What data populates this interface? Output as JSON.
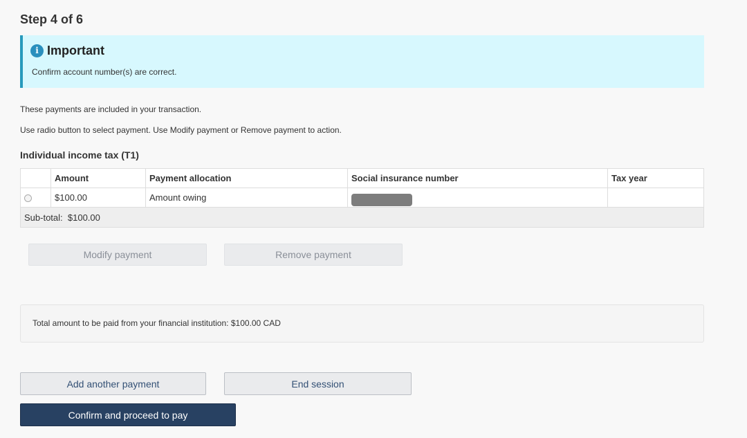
{
  "step": "Step 4 of 6",
  "alert": {
    "icon": "info-icon",
    "icon_glyph": "i",
    "title": "Important",
    "body": "Confirm account number(s) are correct.",
    "accent_color": "#269abc",
    "background_color": "#d7f8fe"
  },
  "intro": {
    "line1": "These payments are included in your transaction.",
    "line2": "Use radio button to select payment. Use Modify payment or Remove payment to action."
  },
  "section_title": "Individual income tax (T1)",
  "table": {
    "headers": {
      "amount": "Amount",
      "allocation": "Payment allocation",
      "sin": "Social insurance number",
      "tax_year": "Tax year"
    },
    "rows": [
      {
        "selected": false,
        "amount": "$100.00",
        "allocation": "Amount owing",
        "sin": "",
        "sin_redacted": true,
        "tax_year": ""
      }
    ],
    "subtotal_label": "Sub-total:",
    "subtotal_value": "$100.00"
  },
  "row_actions": {
    "modify": "Modify payment",
    "remove": "Remove payment",
    "disabled": true
  },
  "total": {
    "label": "Total amount to be paid from your financial institution:",
    "value": "$100.00 CAD"
  },
  "actions": {
    "add_another": "Add another payment",
    "end_session": "End session",
    "confirm": "Confirm and proceed to pay"
  },
  "colors": {
    "primary_button": "#284162",
    "default_button_text": "#335075"
  }
}
